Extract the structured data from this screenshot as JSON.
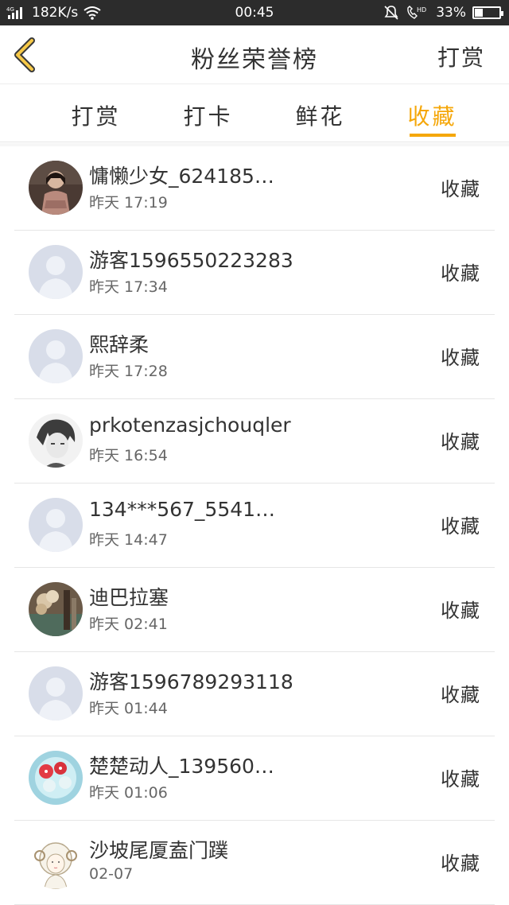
{
  "status_bar": {
    "network": "4G",
    "speed": "182K/s",
    "time": "00:45",
    "hd": "HD",
    "battery": "33%",
    "battery_level": 0.33
  },
  "header": {
    "title": "粉丝荣誉榜",
    "right_action": "打赏"
  },
  "tabs": [
    {
      "label": "打赏",
      "active": false
    },
    {
      "label": "打卡",
      "active": false
    },
    {
      "label": "鲜花",
      "active": false
    },
    {
      "label": "收藏",
      "active": true
    }
  ],
  "colors": {
    "accent": "#f5a70a",
    "status_bar": "#2c2c2c",
    "divider": "#e6e6e6",
    "default_avatar": "#d8dde9"
  },
  "rows": [
    {
      "name": "慵懒少女_624185…",
      "time": "昨天 17:19",
      "action": "收藏",
      "avatar": "photo-girl"
    },
    {
      "name": "游客1596550223283",
      "time": "昨天 17:34",
      "action": "收藏",
      "avatar": "default-user-icon"
    },
    {
      "name": "熙辞柔",
      "time": "昨天 17:28",
      "action": "收藏",
      "avatar": "default-user-icon"
    },
    {
      "name": "prkotenzasjchouqler",
      "time": "昨天 16:54",
      "action": "收藏",
      "avatar": "anime-sketch"
    },
    {
      "name": "134***567_5541…",
      "time": "昨天 14:47",
      "action": "收藏",
      "avatar": "default-user-icon"
    },
    {
      "name": "迪巴拉塞",
      "time": "昨天 02:41",
      "action": "收藏",
      "avatar": "photo-flowers"
    },
    {
      "name": "游客1596789293118",
      "time": "昨天 01:44",
      "action": "收藏",
      "avatar": "default-user-icon"
    },
    {
      "name": "楚楚动人_139560…",
      "time": "昨天 01:06",
      "action": "收藏",
      "avatar": "photo-cakes"
    },
    {
      "name": "沙坡尾厦盍门蹼",
      "time": "02-07",
      "action": "收藏",
      "avatar": "cartoon-sheep"
    }
  ]
}
